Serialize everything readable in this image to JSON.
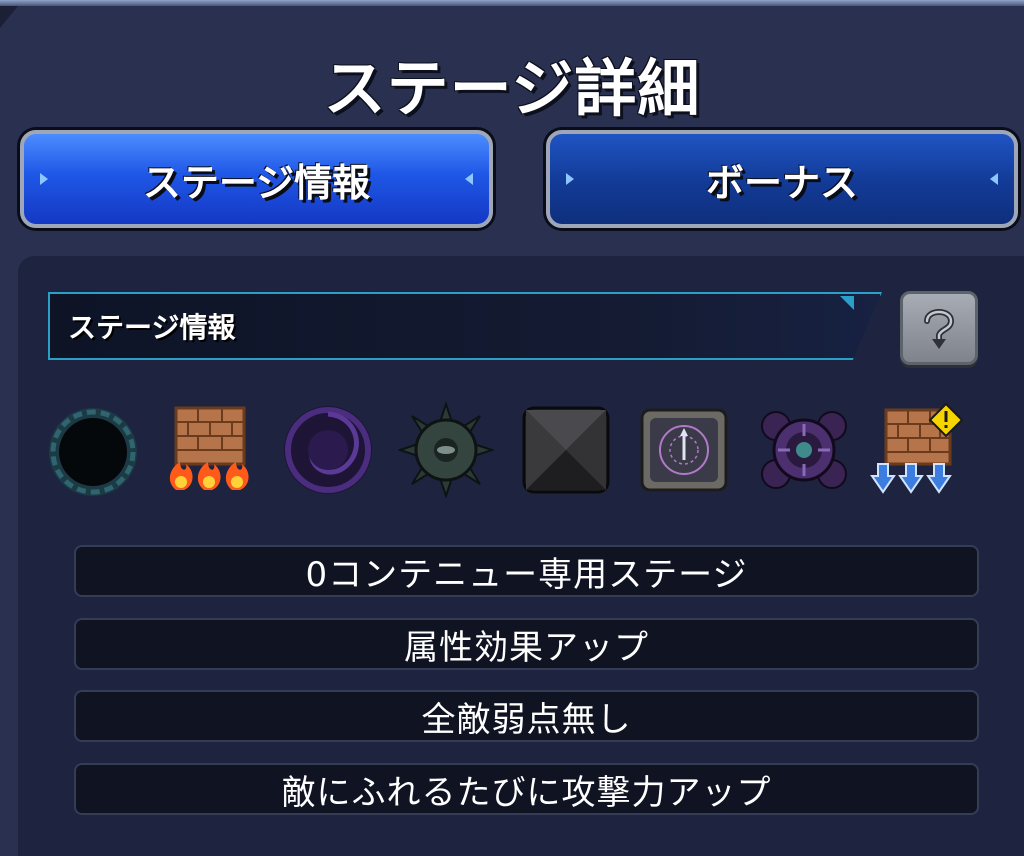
{
  "header": {
    "title": "ステージ詳細"
  },
  "tabs": [
    {
      "label": "ステージ情報",
      "active": true
    },
    {
      "label": "ボーナス",
      "active": false
    }
  ],
  "info": {
    "section_label": "ステージ情報",
    "help_icon": "question-icon"
  },
  "gimmicks": [
    {
      "icon": "black-hole-icon"
    },
    {
      "icon": "fire-wall-icon"
    },
    {
      "icon": "vortex-icon"
    },
    {
      "icon": "spiked-mine-icon"
    },
    {
      "icon": "pyramid-block-icon"
    },
    {
      "icon": "magic-panel-icon"
    },
    {
      "icon": "gravity-barrier-icon"
    },
    {
      "icon": "ice-wall-warning-icon"
    }
  ],
  "rules": [
    "0コンテニュー専用ステージ",
    "属性効果アップ",
    "全敵弱点無し",
    "敵にふれるたびに攻撃力アップ"
  ],
  "colors": {
    "background": "#2a3150",
    "tab_active": "#1f57e6",
    "tab_inactive": "#123a96",
    "info_border": "#2aa0c8",
    "warning": "#f5d400"
  }
}
